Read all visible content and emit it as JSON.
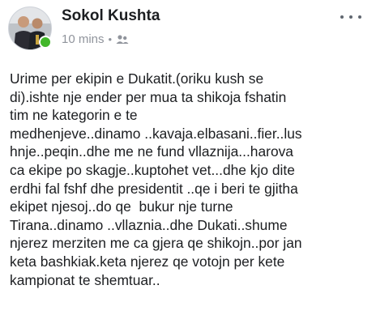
{
  "post": {
    "author": "Sokol Kushta",
    "time": "10 mins",
    "separator": "•",
    "audience_icon": "friends-icon",
    "more_icon": "more-horizontal-icon",
    "online_color": "#42b72a",
    "body_lines": [
      "Urime per ekipin e Dukatit.(oriku kush se",
      "di).ishte nje ender per mua ta shikoja fshatin",
      "tim ne kategorin e te",
      "medhenjeve..dinamo ..kavaja.elbasani..fier..lus",
      "hnje..peqin..dhe me ne fund vllaznija...harova",
      "ca ekipe po skagje..kuptohet vet...dhe kjo dite",
      "erdhi fal fshf dhe presidentit ..qe i beri te gjitha",
      "ekipet njesoj..do qe  bukur nje turne",
      "Tirana..dinamo ..vllaznia..dhe Dukati..shume",
      "njerez merziten me ca gjera qe shikojn..por jan",
      "keta bashkiak.keta njerez qe votojn per kete",
      "kampionat te shemtuar.."
    ]
  }
}
